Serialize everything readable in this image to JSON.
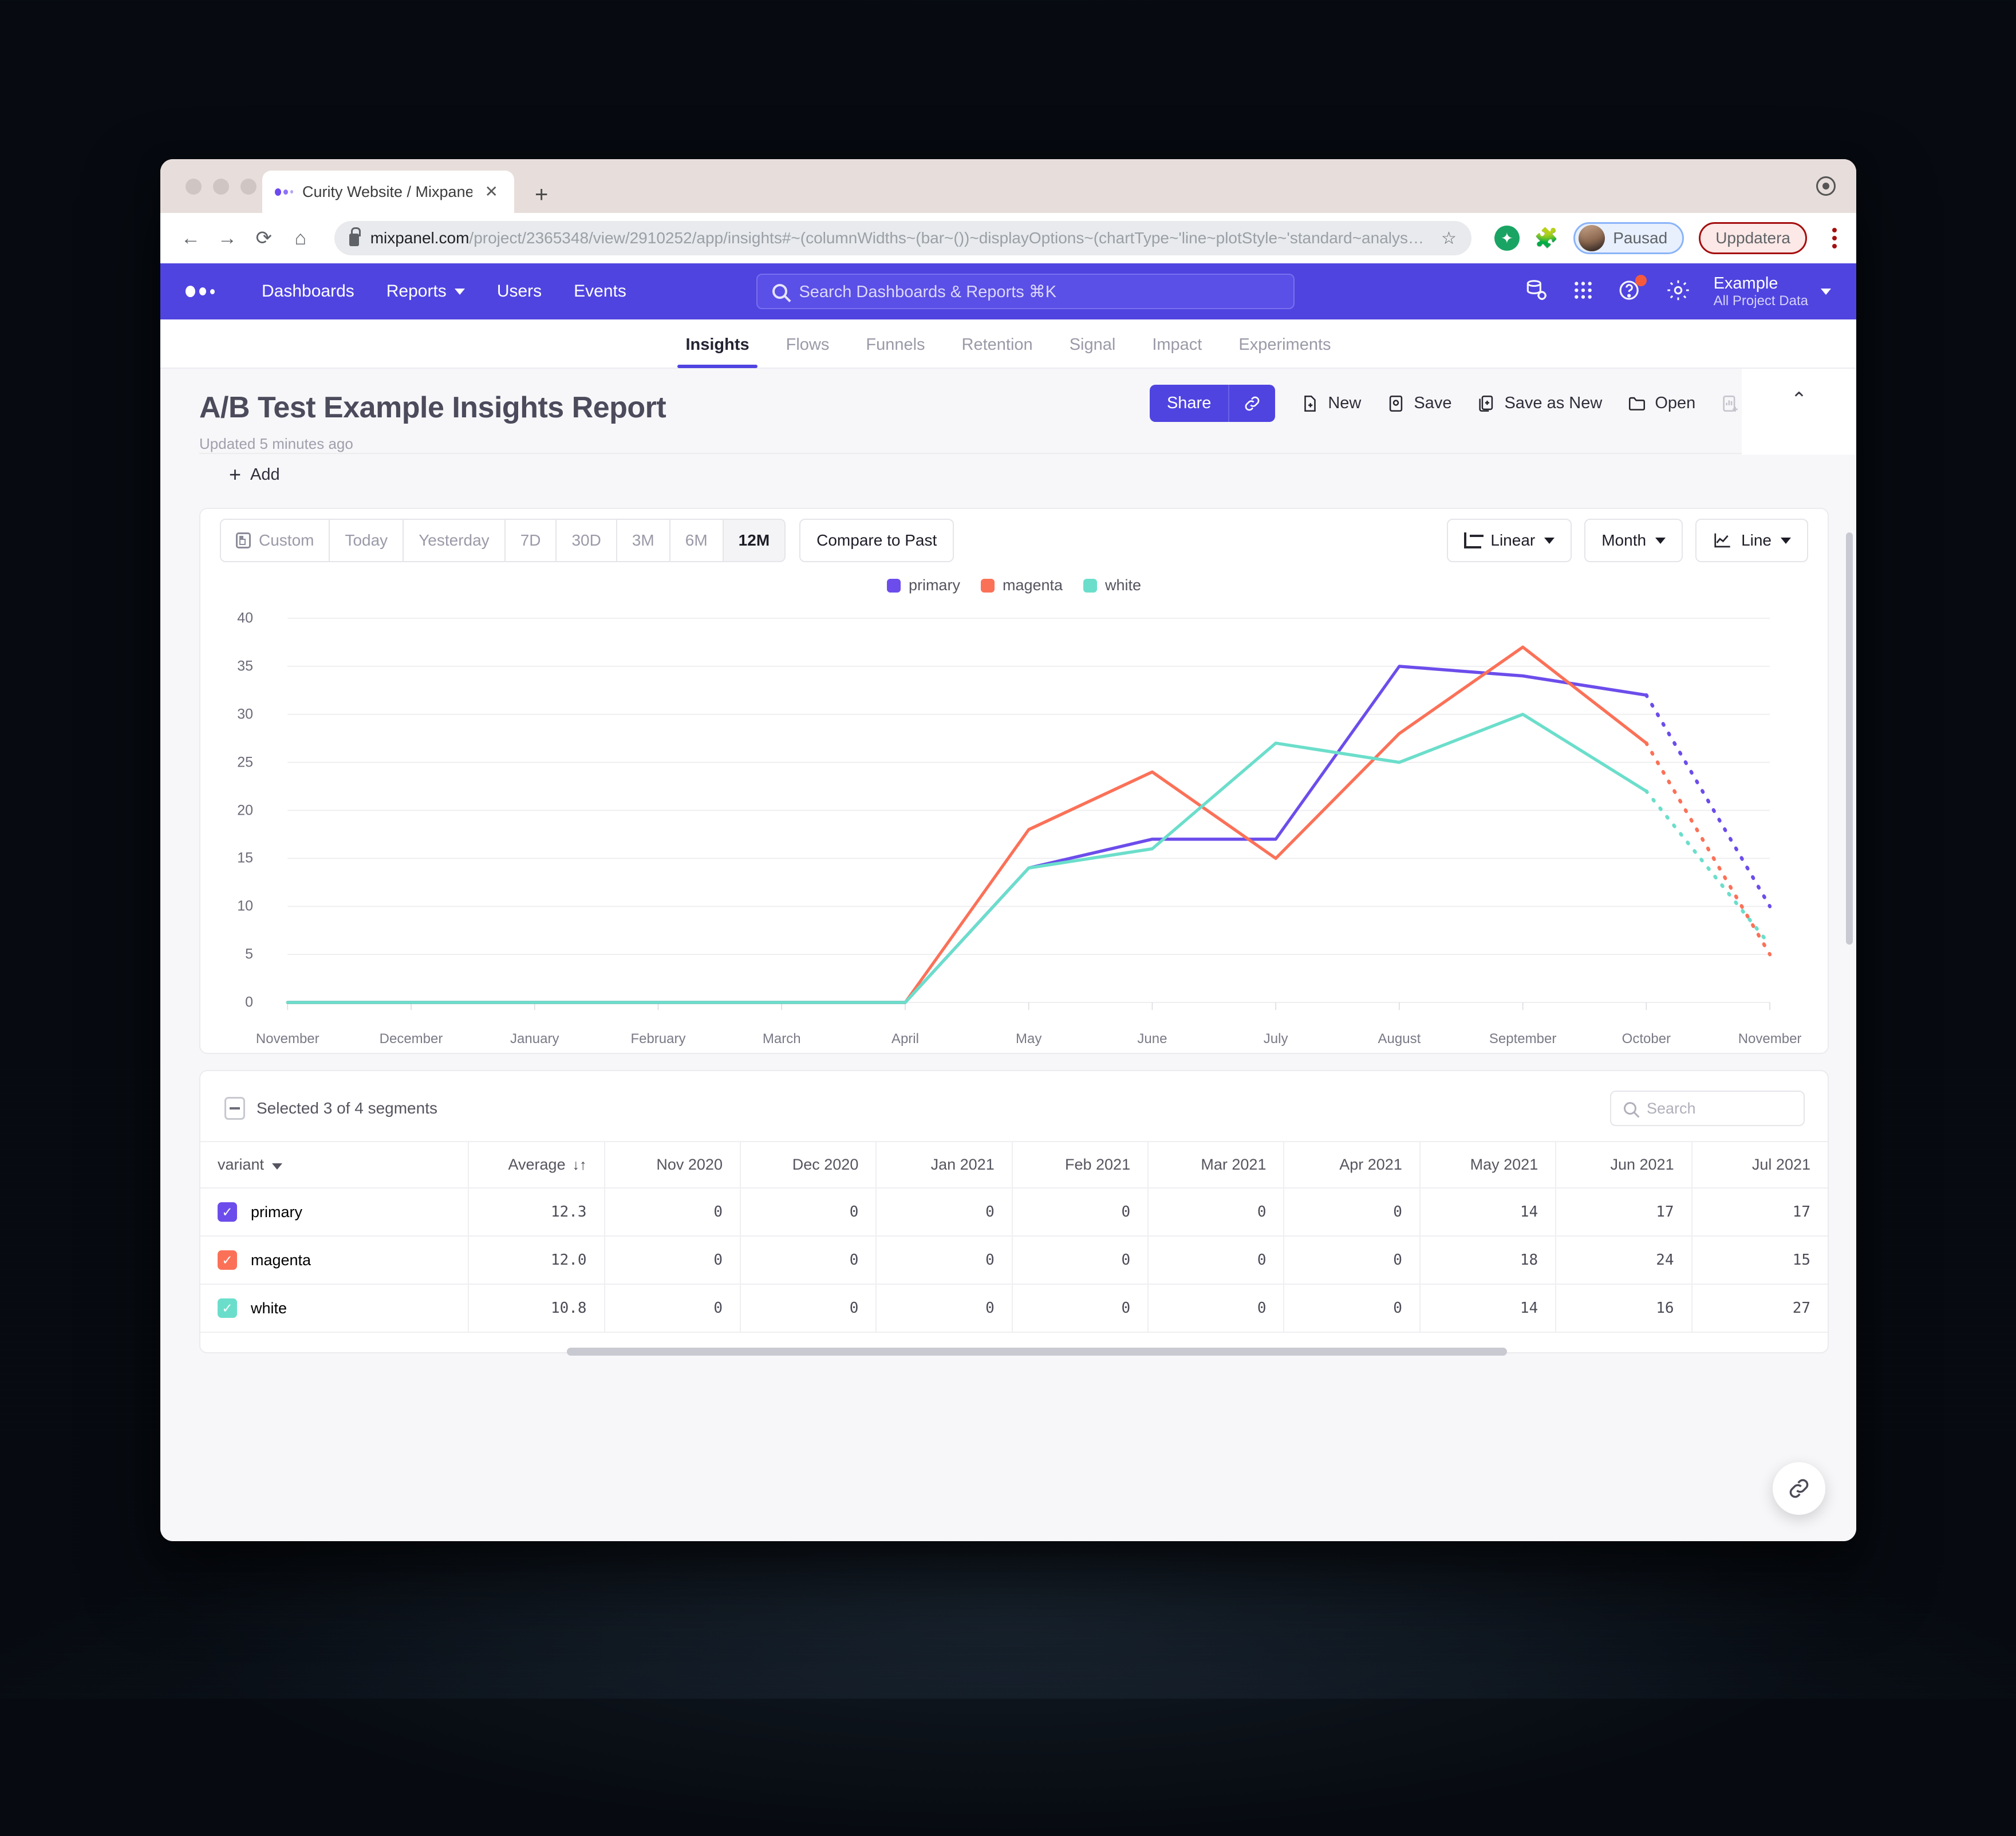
{
  "browser": {
    "tab_title": "Curity Website / Mixpanel",
    "tab_close": "✕",
    "new_tab": "+",
    "url_host": "mixpanel.com",
    "url_path": "/project/2365348/view/2910252/app/insights#~(columnWidths~(bar~())~displayOptions~(chartType~'line~plotStyle~'standard~analys…",
    "profile_label": "Pausad",
    "update_label": "Uppdatera"
  },
  "nav": {
    "items": [
      "Dashboards",
      "Reports",
      "Users",
      "Events"
    ],
    "search_placeholder": "Search Dashboards & Reports ⌘K",
    "project_name": "Example",
    "project_scope": "All Project Data"
  },
  "tabs": [
    {
      "label": "Insights",
      "active": true
    },
    {
      "label": "Flows",
      "active": false
    },
    {
      "label": "Funnels",
      "active": false
    },
    {
      "label": "Retention",
      "active": false
    },
    {
      "label": "Signal",
      "active": false
    },
    {
      "label": "Impact",
      "active": false
    },
    {
      "label": "Experiments",
      "active": false
    }
  ],
  "report": {
    "title": "A/B Test Example Insights Report",
    "updated": "Updated 5 minutes ago",
    "add_label": "Add"
  },
  "actions": {
    "share": "Share",
    "new": "New",
    "save": "Save",
    "save_as_new": "Save as New",
    "open": "Open",
    "more": "ooo",
    "collapse": "⌃"
  },
  "chart_controls": {
    "ranges": [
      "Custom",
      "Today",
      "Yesterday",
      "7D",
      "30D",
      "3M",
      "6M",
      "12M"
    ],
    "active_range": "12M",
    "compare": "Compare to Past",
    "scale": "Linear",
    "interval": "Month",
    "chart_type": "Line"
  },
  "table": {
    "selected_label": "Selected 3 of 4 segments",
    "search_placeholder": "Search",
    "variant_header": "variant",
    "average_header": "Average",
    "columns": [
      "Nov 2020",
      "Dec 2020",
      "Jan 2021",
      "Feb 2021",
      "Mar 2021",
      "Apr 2021",
      "May 2021",
      "Jun 2021",
      "Jul 2021"
    ],
    "rows": [
      {
        "name": "primary",
        "color": "#6C4DEB",
        "average": "12.3",
        "values": [
          "0",
          "0",
          "0",
          "0",
          "0",
          "0",
          "14",
          "17",
          "17"
        ]
      },
      {
        "name": "magenta",
        "color": "#FB7158",
        "average": "12.0",
        "values": [
          "0",
          "0",
          "0",
          "0",
          "0",
          "0",
          "18",
          "24",
          "15"
        ]
      },
      {
        "name": "white",
        "color": "#6BDECB",
        "average": "10.8",
        "values": [
          "0",
          "0",
          "0",
          "0",
          "0",
          "0",
          "14",
          "16",
          "27"
        ]
      }
    ]
  },
  "chart_data": {
    "type": "line",
    "title": "",
    "xlabel": "",
    "ylabel": "",
    "ylim": [
      0,
      40
    ],
    "yticks": [
      0,
      5,
      10,
      15,
      20,
      25,
      30,
      35,
      40
    ],
    "grid": true,
    "legend_position": "top-center",
    "categories": [
      "November",
      "December",
      "January",
      "February",
      "March",
      "April",
      "May",
      "June",
      "July",
      "August",
      "September",
      "October",
      "November"
    ],
    "series": [
      {
        "name": "primary",
        "color": "#6C4DEB",
        "values": [
          0,
          0,
          0,
          0,
          0,
          0,
          14,
          17,
          17,
          35,
          34,
          32,
          10
        ],
        "projected_from_index": 11
      },
      {
        "name": "magenta",
        "color": "#FB7158",
        "values": [
          0,
          0,
          0,
          0,
          0,
          0,
          18,
          24,
          15,
          28,
          37,
          27,
          5
        ],
        "projected_from_index": 11
      },
      {
        "name": "white",
        "color": "#6BDECB",
        "values": [
          0,
          0,
          0,
          0,
          0,
          0,
          14,
          16,
          27,
          25,
          30,
          22,
          6
        ],
        "projected_from_index": 11
      }
    ]
  }
}
